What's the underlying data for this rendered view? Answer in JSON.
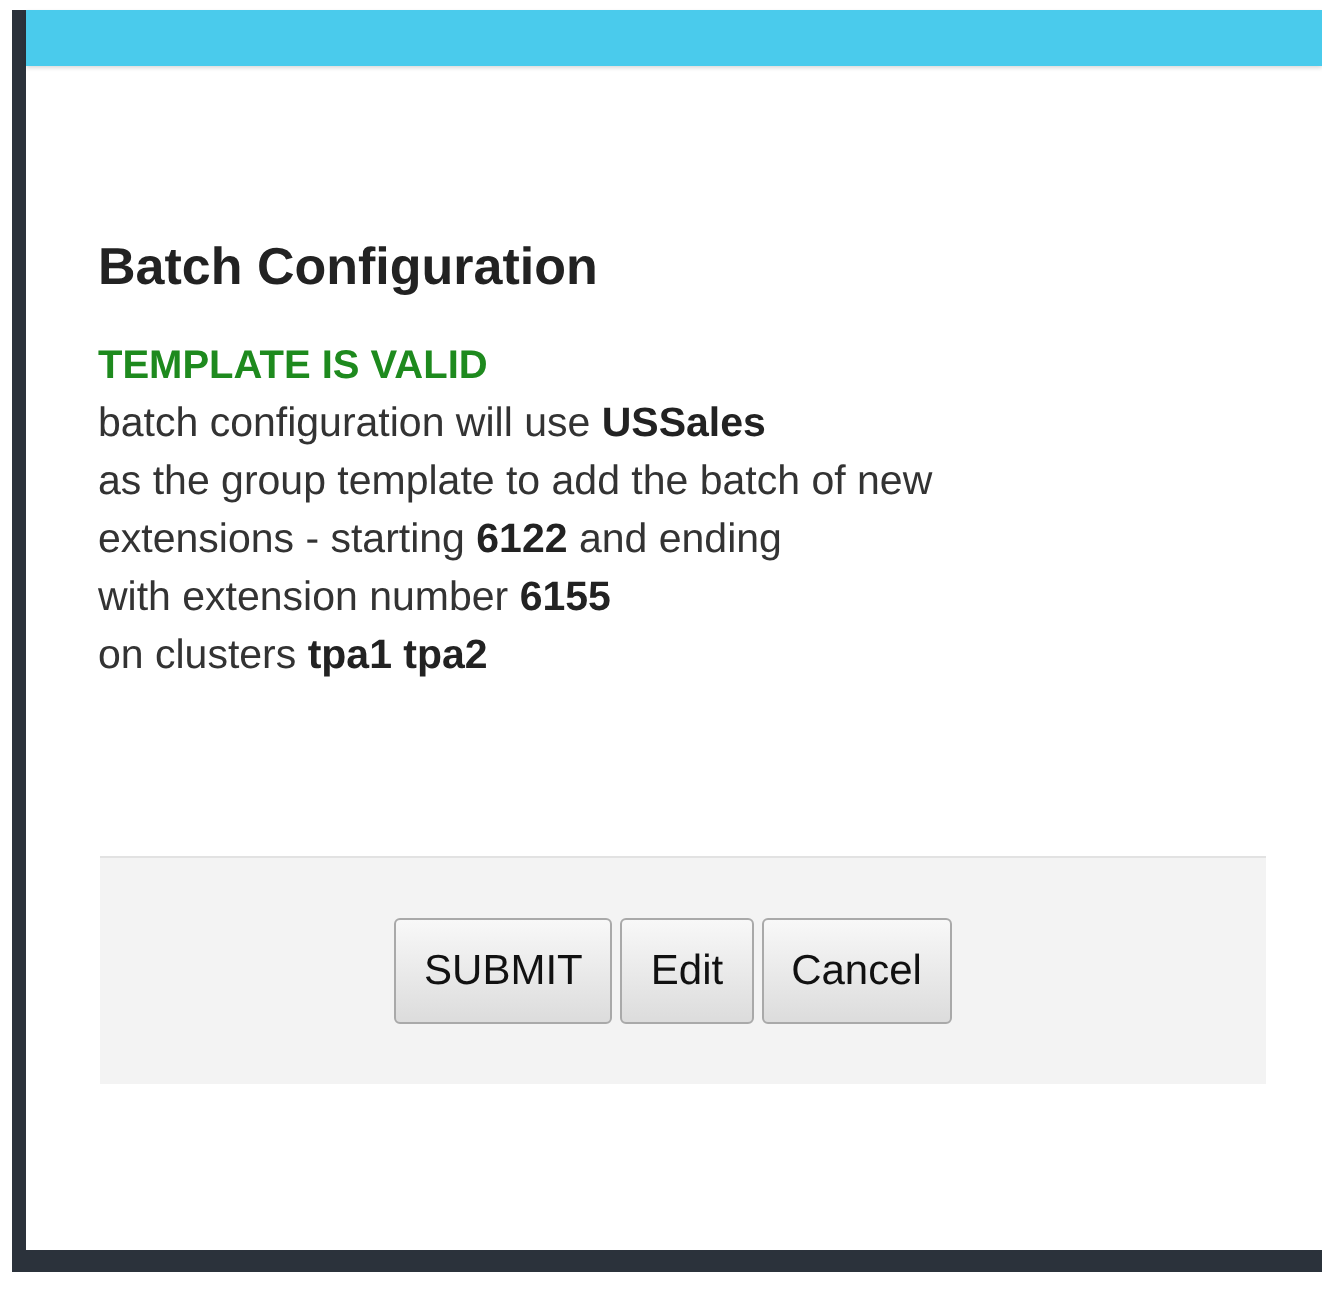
{
  "dialog": {
    "title": "Batch Configuration",
    "status": "TEMPLATE IS VALID",
    "message_lines": [
      "batch configuration will use **USSales**",
      "as the group template to add the batch of new",
      "extensions - starting **6122** and ending",
      "with extension number **6155**",
      "on clusters **tpa1 tpa2**"
    ],
    "buttons": [
      "SUBMIT",
      "Edit",
      "Cancel"
    ]
  }
}
